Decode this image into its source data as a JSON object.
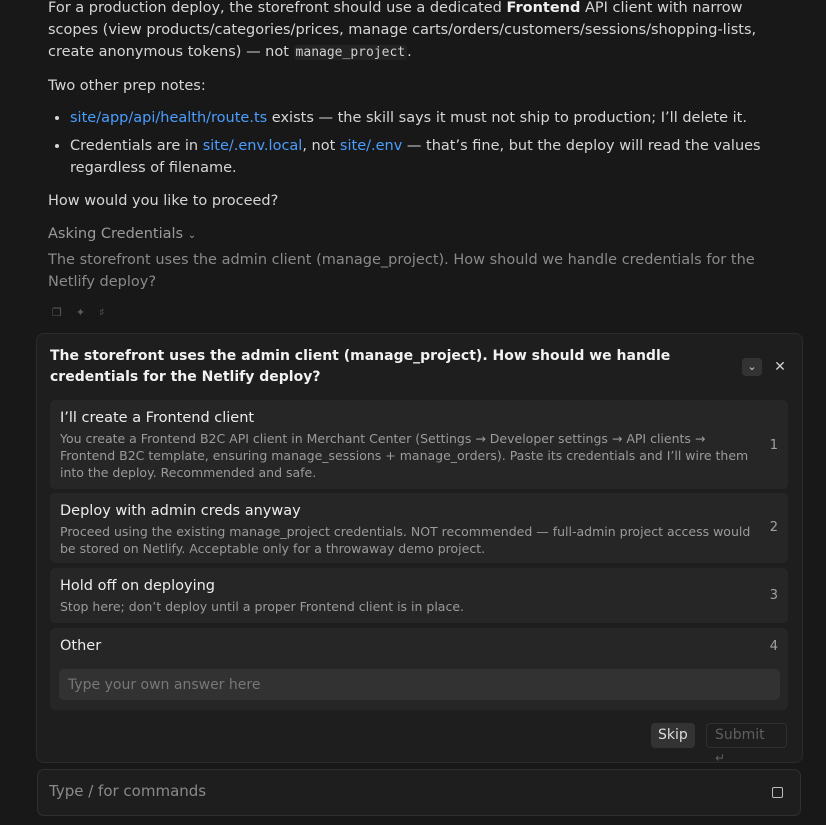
{
  "message": {
    "p1": {
      "t1": "For a production deploy, the storefront should use a dedicated ",
      "bold": "Frontend",
      "t2": " API client with narrow scopes (view products/categories/prices, manage carts/orders/customers/sessions/shopping-lists, create anonymous tokens) — not ",
      "code": "manage_project",
      "t3": "."
    },
    "p2": "Two other prep notes:",
    "bullet1": {
      "link": "site/app/api/health/route.ts",
      "text": " exists — the skill says it must not ship to production; I’ll delete it."
    },
    "bullet2": {
      "t1": "Credentials are in ",
      "link1": "site/.env.local",
      "t2": ", not ",
      "link2": "site/.env",
      "t3": " — that’s fine, but the deploy will read the values regardless of filename."
    },
    "p3": "How would you like to proceed?",
    "asking_prefix": "Asking",
    "asking_category": "Credentials",
    "question_echo": "The storefront uses the admin client (manage_project). How should we handle credentials for the Netlify deploy?"
  },
  "icons": {
    "copy": "copy-icon",
    "pin": "pin-icon",
    "speaker": "speaker-icon",
    "collapse": "chevron-down-icon",
    "close": "close-icon",
    "enter": "enter-icon",
    "stop": "stop-icon"
  },
  "panel": {
    "question": "The storefront uses the admin client (manage_project). How should we handle credentials for the Netlify deploy?",
    "options": [
      {
        "title": "I’ll create a Frontend client",
        "desc": "You create a Frontend B2C API client in Merchant Center (Settings → Developer settings → API clients → Frontend B2C template, ensuring manage_sessions + manage_orders). Paste its credentials and I’ll wire them into the deploy. Recommended and safe.",
        "num": "1"
      },
      {
        "title": "Deploy with admin creds anyway",
        "desc": "Proceed using the existing manage_project credentials. NOT recommended — full-admin project access would be stored on Netlify. Acceptable only for a throwaway demo project.",
        "num": "2"
      },
      {
        "title": "Hold off on deploying",
        "desc": "Stop here; don’t deploy until a proper Frontend client is in place.",
        "num": "3"
      },
      {
        "title": "Other",
        "num": "4",
        "placeholder": "Type your own answer here"
      }
    ],
    "skip_label": "Skip",
    "submit_label": "Submit"
  },
  "composer": {
    "placeholder": "Type / for commands"
  }
}
